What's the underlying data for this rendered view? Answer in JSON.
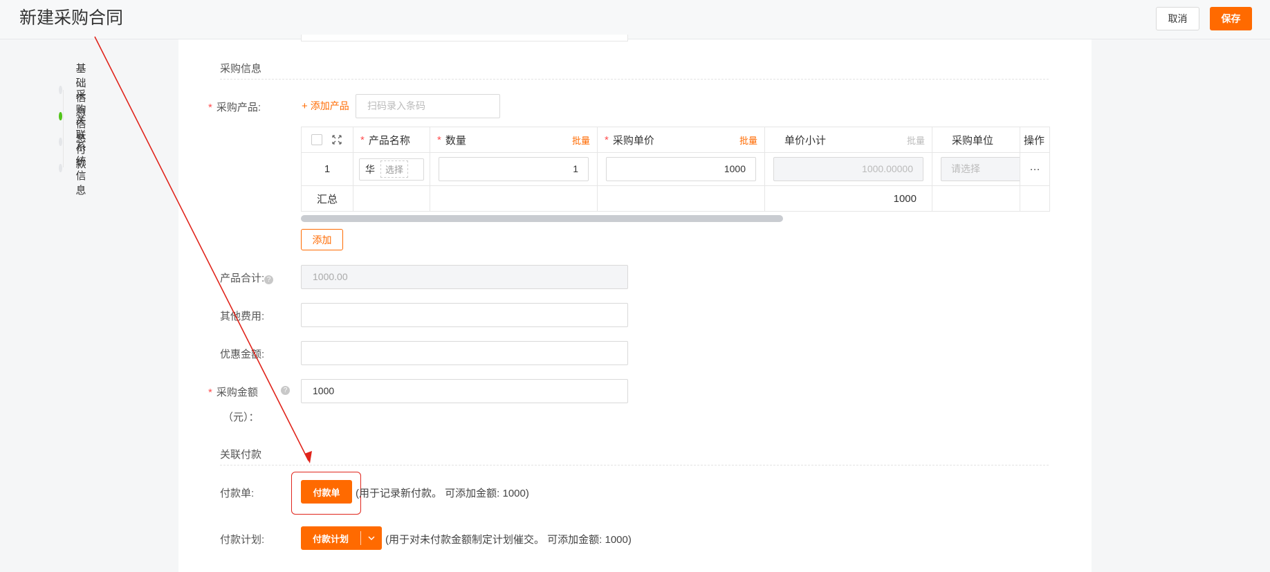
{
  "header": {
    "title": "新建采购合同",
    "cancel_label": "取消",
    "save_label": "保存"
  },
  "steps": [
    {
      "label": "基础信息",
      "active": false
    },
    {
      "label": "采购信息",
      "active": true
    },
    {
      "label": "关联付款",
      "active": false
    },
    {
      "label": "系统信息",
      "active": false
    }
  ],
  "purchase": {
    "section_title": "采购信息",
    "products_label": "采购产品:",
    "add_product_label": "添加产品",
    "barcode_placeholder": "扫码录入条码",
    "table": {
      "columns": {
        "name": "产品名称",
        "qty": "数量",
        "unit_price": "采购单价",
        "subtotal": "单价小计",
        "unit": "采购单位",
        "ops": "操作"
      },
      "batch_label": "批量",
      "row": {
        "index": "1",
        "name_value": "华",
        "select_label": "选择",
        "qty": "1",
        "unit_price": "1000",
        "subtotal": "1000.00000",
        "unit_placeholder": "请选择",
        "ops": "···"
      },
      "summary": {
        "label": "汇总",
        "subtotal_total": "1000"
      }
    },
    "add_row_label": "添加",
    "product_total_label": "产品合计:",
    "product_total_value": "1000.00",
    "other_fees_label": "其他费用:",
    "discount_label": "优惠金额:",
    "amount_label_1": "采购金额",
    "amount_label_2": "（元）：",
    "amount_value": "1000"
  },
  "payment": {
    "section_title": "关联付款",
    "payment_label": "付款单:",
    "payment_button": "付款单",
    "payment_hint": "(用于记录新付款。 可添加金额: 1000)",
    "plan_label": "付款计划:",
    "plan_button": "付款计划",
    "plan_hint": "(用于对未付款金额制定计划催交。 可添加金额: 1000)"
  },
  "colors": {
    "accent": "#ff6a00",
    "active_step": "#52c41a",
    "required": "#ff4d4f",
    "annotation": "#e0241b"
  }
}
